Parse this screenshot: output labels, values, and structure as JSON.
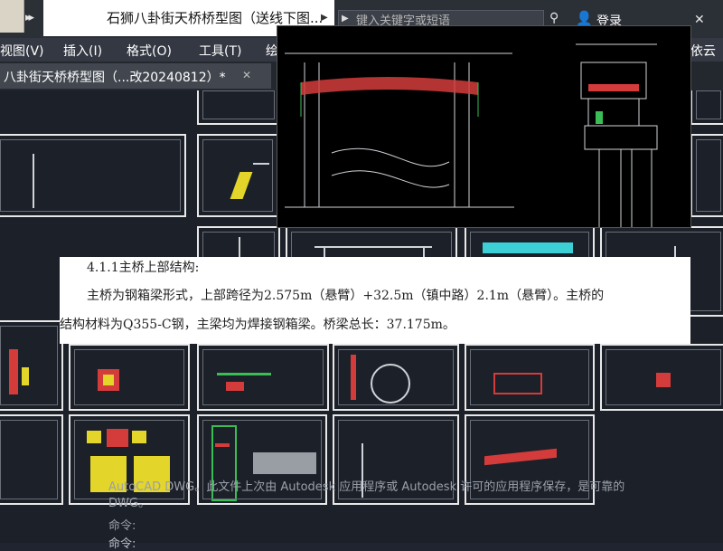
{
  "titlebar": {
    "quick_access_nav": "▸▸",
    "title": "石狮八卦街天桥桥型图（送线下图...",
    "search_placeholder": "键入关键字或短语",
    "login": "登录"
  },
  "menubar": {
    "items": [
      "视图(V)",
      "插入(I)",
      "格式(O)",
      "工具(T)",
      "绘",
      "依云"
    ]
  },
  "doc_tab": {
    "label": "八卦街天桥桥型图（...改20240812）*",
    "close": "✕"
  },
  "document": {
    "heading": "4.1.1主桥上部结构:",
    "line1": "主桥为钢箱梁形式，上部跨径为2.575m（悬臂）+32.5m（镇中路）2.1m（悬臂）。主桥的",
    "line2": "结构材料为Q355-C钢，主梁均为焊接钢箱梁。桥梁总长：37.175m。"
  },
  "command": {
    "message": "AutoCAD DWG。此文件上次由 Autodesk 应用程序或 Autodesk 许可的应用程序保存，是可靠的",
    "message_tail": "DWG。",
    "prompt1": "命令:",
    "prompt2": "命令:"
  },
  "colors": {
    "canvas_bg": "#1c2028",
    "sheet_border": "#e8e8e8",
    "accent_yellow": "#e3d52a",
    "accent_red": "#d43c3c"
  }
}
